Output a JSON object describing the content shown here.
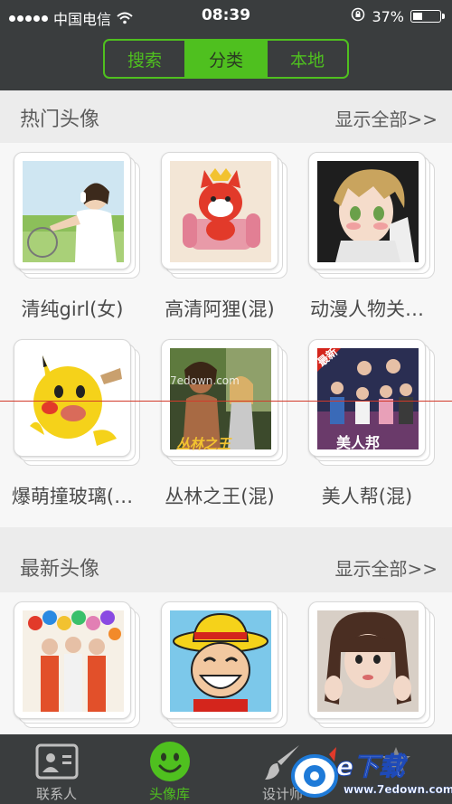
{
  "status_bar": {
    "carrier": "中国电信",
    "time": "08:39",
    "battery_percent": "37%",
    "battery_level": 0.37
  },
  "segmented": {
    "items": [
      "搜索",
      "分类",
      "本地"
    ],
    "selected": "分类"
  },
  "sections": [
    {
      "title": "热门头像",
      "more": "显示全部>>",
      "items": [
        {
          "caption": "清纯girl(女)",
          "image": "girl-with-headphones"
        },
        {
          "caption": "高清阿狸(混)",
          "image": "red-fox-cartoon"
        },
        {
          "caption": "动漫人物关…",
          "image": "anime-boy"
        },
        {
          "caption": "爆萌撞玻璃(…",
          "image": "pikachu-glass"
        },
        {
          "caption": "丛林之王(混)",
          "image": "tarzan-poster",
          "poster_text": "丛林之王"
        },
        {
          "caption": "美人帮(混)",
          "image": "drama-poster",
          "poster_text": "美人邦",
          "ribbon": "最新"
        }
      ]
    },
    {
      "title": "最新头像",
      "more": "显示全部>>",
      "items": [
        {
          "image": "group-with-balloons"
        },
        {
          "image": "straw-hat-cartoon"
        },
        {
          "image": "girl-with-pigtails"
        }
      ]
    }
  ],
  "watermark": "7edown.com",
  "tabs": [
    {
      "label": "联系人",
      "icon": "contact-card-icon"
    },
    {
      "label": "头像库",
      "icon": "smiley-icon",
      "active": true
    },
    {
      "label": "设计师",
      "icon": "brush-icon"
    },
    {
      "label": "",
      "icon": "more-icon"
    }
  ],
  "site_logo": {
    "name": "e下载",
    "url": "www.7edown.com"
  },
  "colors": {
    "accent": "#4fc01f",
    "bar_background": "#3a3d3e",
    "page_background": "#ececec"
  }
}
